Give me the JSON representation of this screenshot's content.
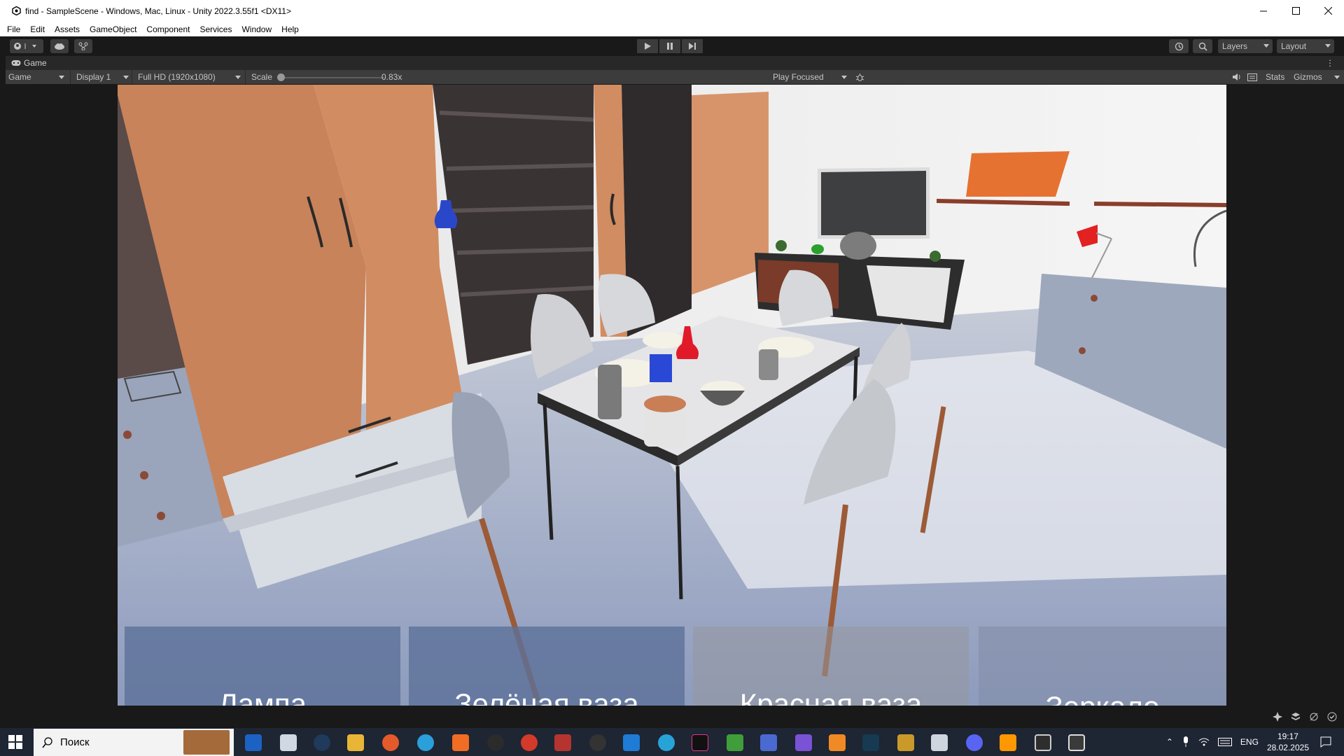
{
  "window": {
    "title": "find - SampleScene - Windows, Mac, Linux - Unity 2022.3.55f1 <DX11>",
    "minimize_icon": "minimize-icon",
    "maximize_icon": "maximize-icon",
    "close_icon": "close-icon"
  },
  "menu": [
    "File",
    "Edit",
    "Assets",
    "GameObject",
    "Component",
    "Services",
    "Window",
    "Help"
  ],
  "toolbar": {
    "layers_label": "Layers",
    "layout_label": "Layout",
    "play_icon": "play-icon",
    "pause_icon": "pause-icon",
    "step_icon": "step-icon"
  },
  "game_tab": {
    "label": "Game"
  },
  "game_bar": {
    "mode": "Game",
    "display": "Display 1",
    "resolution": "Full HD (1920x1080)",
    "scale_label": "Scale",
    "scale_value": "0.83x",
    "scale_fraction": 0.0,
    "play_focused": "Play Focused",
    "stats": "Stats",
    "gizmos": "Gizmos"
  },
  "answers": [
    "Лампа",
    "Зелёная ваза",
    "Красная ваза",
    "Зеркало"
  ],
  "taskbar": {
    "search_placeholder": "Поиск",
    "language": "ENG",
    "time": "19:17",
    "date": "28.02.2025"
  },
  "colors": {
    "editor_bg": "#191919",
    "answer_panel": "#5c7198",
    "accent_orange": "#c8835a"
  }
}
